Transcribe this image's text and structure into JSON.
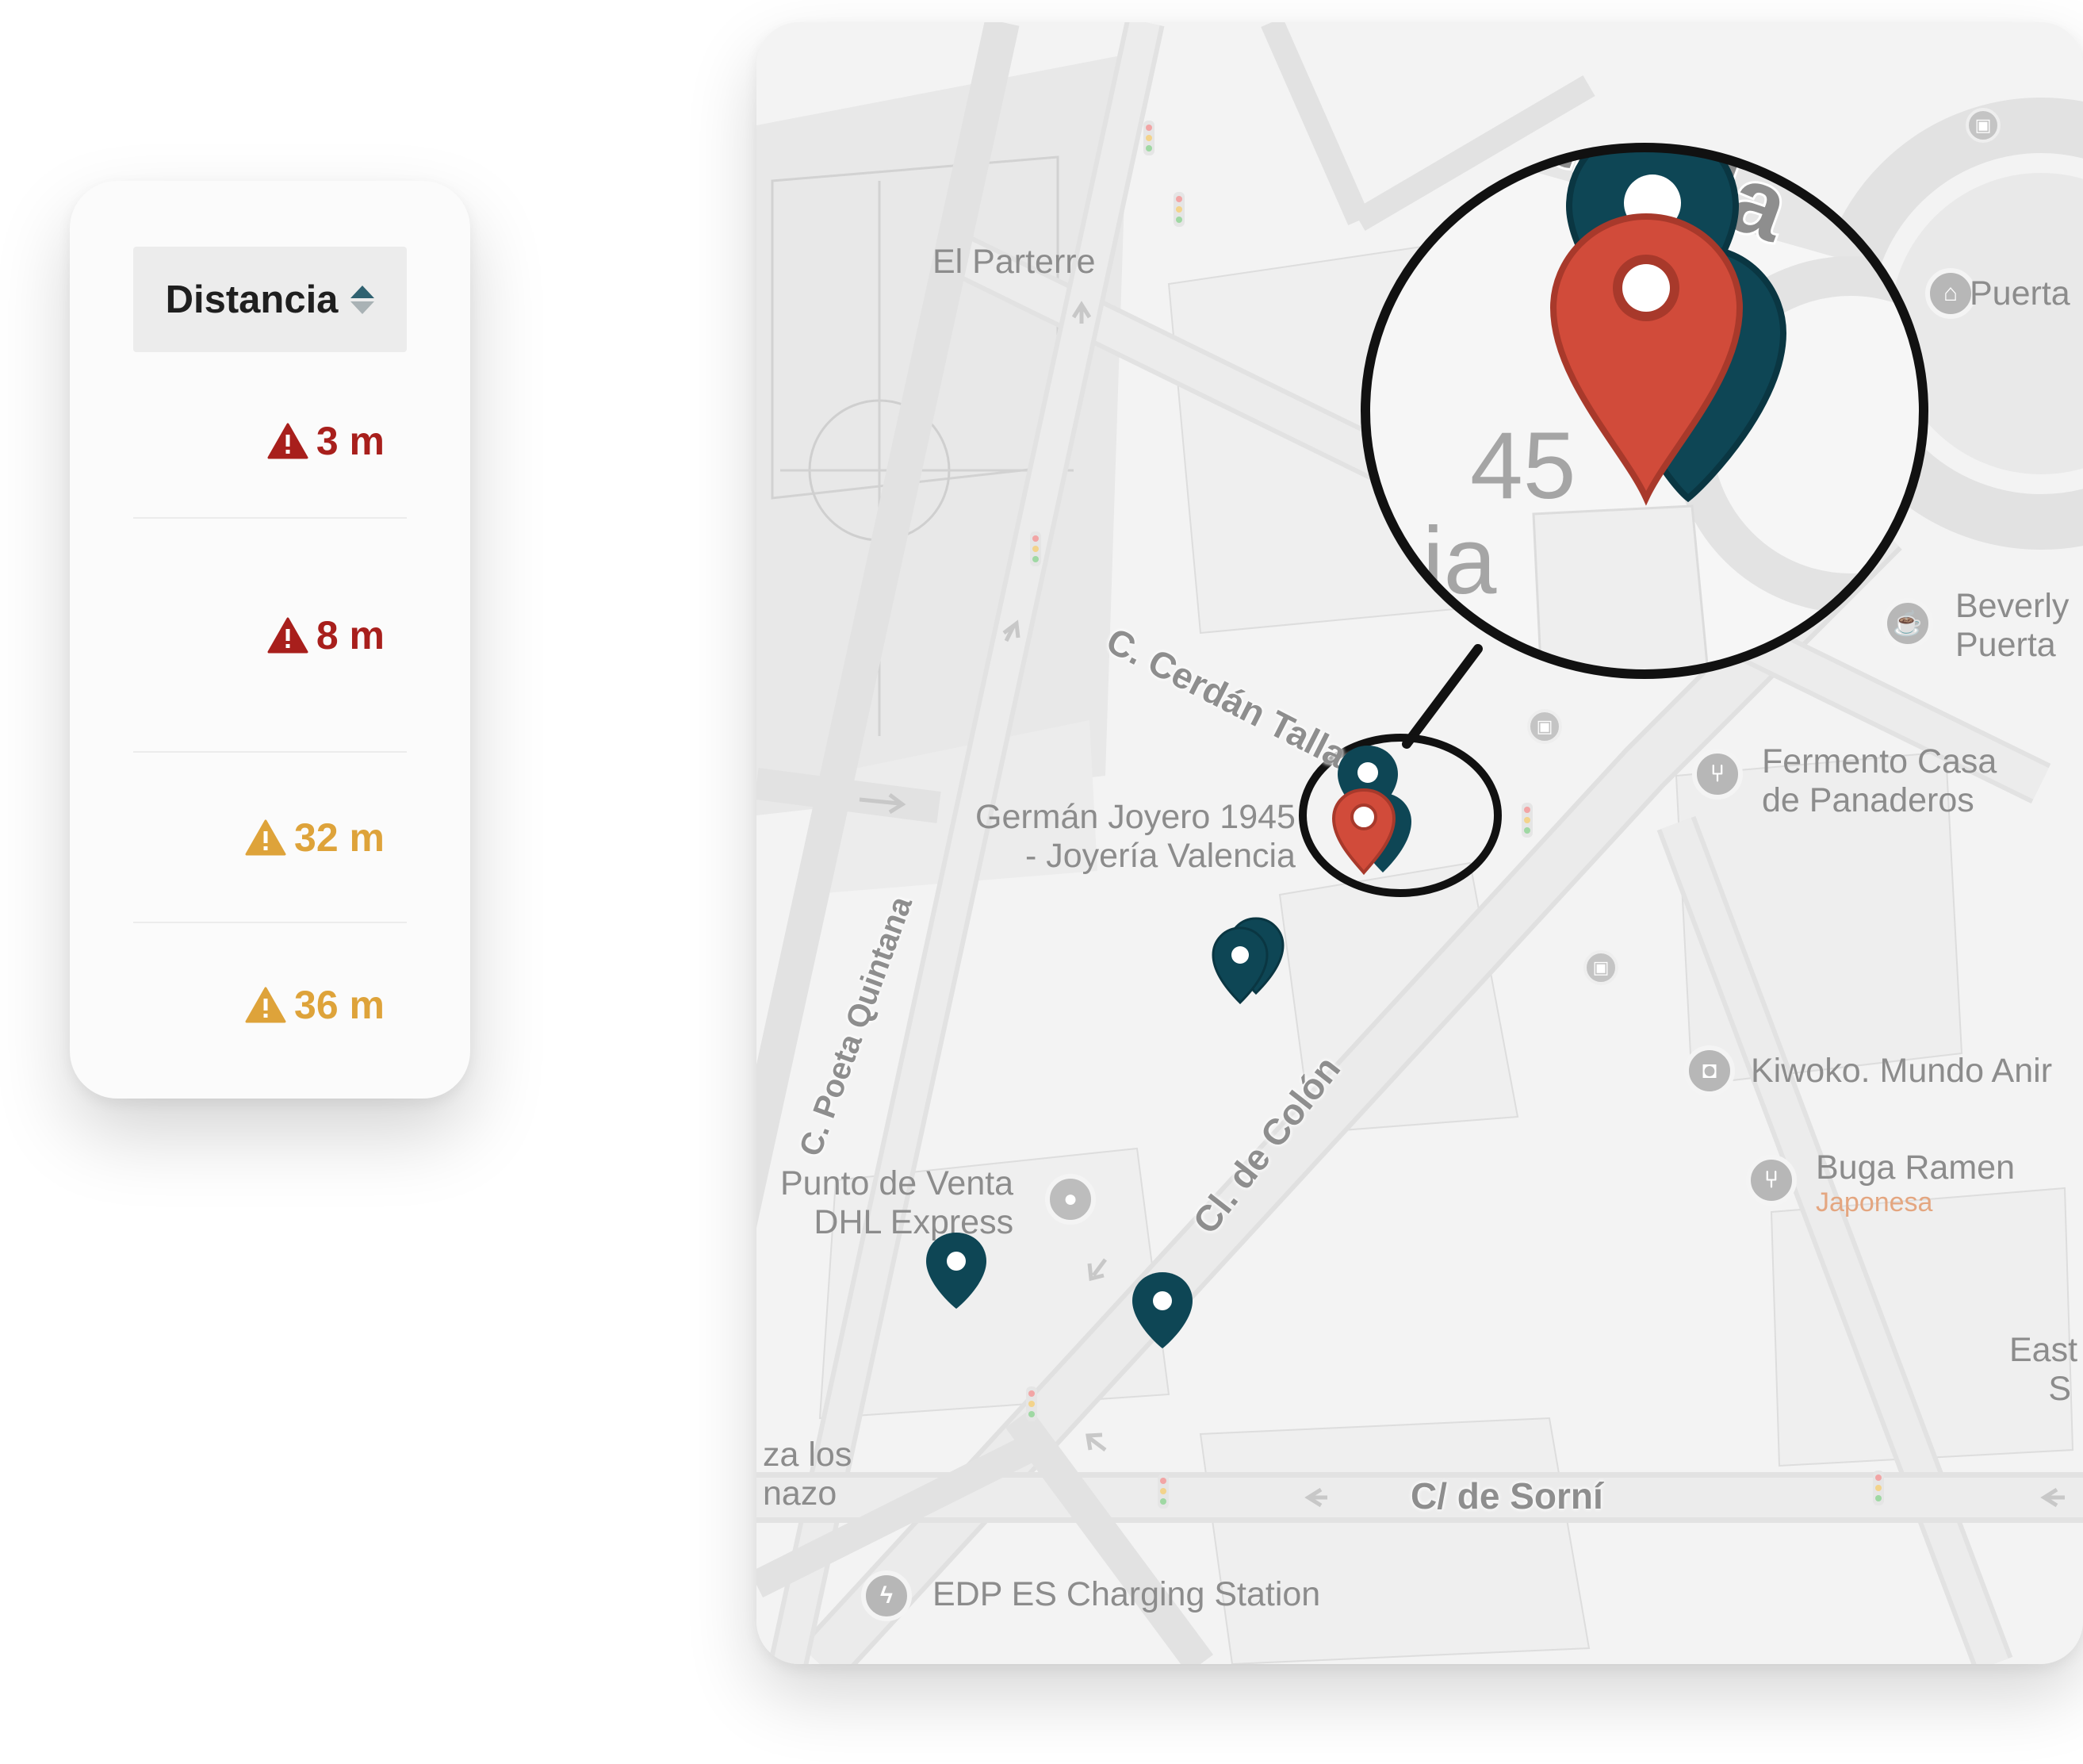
{
  "distance_panel": {
    "header_label": "Distancia",
    "rows": [
      {
        "value": "3 m",
        "severity": "high",
        "color": "#a81f1c"
      },
      {
        "value": "8 m",
        "severity": "high",
        "color": "#a81f1c"
      },
      {
        "value": "32 m",
        "severity": "medium",
        "color": "#dea33a"
      },
      {
        "value": "36 m",
        "severity": "medium",
        "color": "#dea33a"
      }
    ]
  },
  "map": {
    "streets": [
      "C. Cerdán Tallada",
      "C. Poeta Quintana",
      "Cl. de Colón",
      "C/ de Sorní"
    ],
    "pois": [
      {
        "name": "El Parterre"
      },
      {
        "name": "Germán Joyero 1945",
        "subtitle": "- Joyería Valencia"
      },
      {
        "name": "Fermento Casa",
        "subtitle": "de Panaderos",
        "icon": "restaurant-icon"
      },
      {
        "name": "Kiwoko. Mundo Anir",
        "icon": "shopping-bag-icon"
      },
      {
        "name": "Buga Ramen",
        "subtitle": "Japonesa",
        "icon": "restaurant-icon"
      },
      {
        "name": "Punto de Venta",
        "subtitle": "DHL Express",
        "icon": "location-icon"
      },
      {
        "name": "EDP ES Charging Station",
        "icon": "charging-icon"
      },
      {
        "name": "Puerta",
        "icon": "landmark-icon"
      },
      {
        "name": "Beverly",
        "subtitle": "Puerta",
        "icon": "cafe-icon"
      },
      {
        "name": "East",
        "subtitle": "S"
      },
      {
        "name": "za los",
        "subtitle": "nazo"
      }
    ],
    "magnifier": {
      "label_fragments": [
        "allada",
        "45",
        "ia"
      ]
    },
    "marker_colors": {
      "primary": "#0e4655",
      "highlight": "#d14b3a"
    }
  }
}
